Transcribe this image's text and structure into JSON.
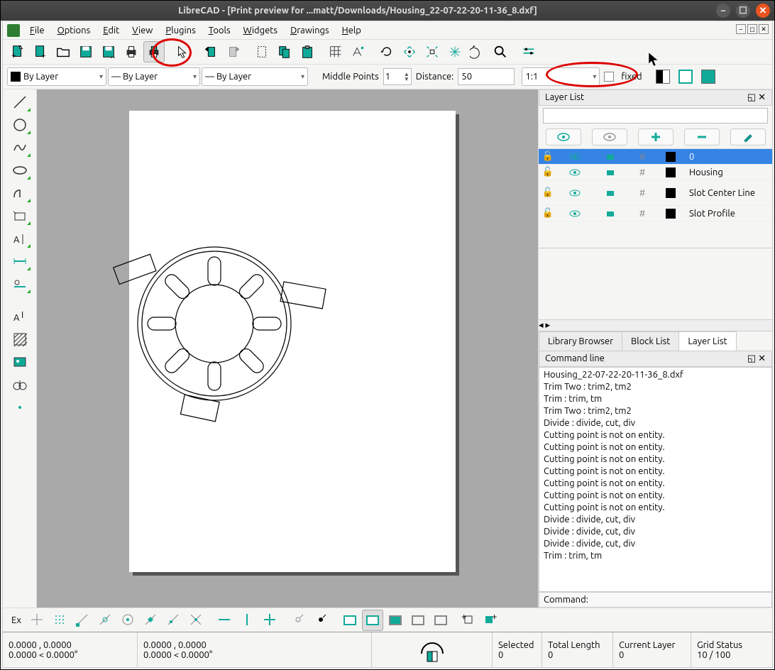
{
  "title": "LibreCAD - [Print preview for ...matt/Downloads/Housing_22-07-22-20-11-36_8.dxf]",
  "menu": {
    "file": "File",
    "options": "Options",
    "edit": "Edit",
    "view": "View",
    "plugins": "Plugins",
    "tools": "Tools",
    "widgets": "Widgets",
    "drawings": "Drawings",
    "help": "Help"
  },
  "row2": {
    "bylayer": "By Layer",
    "middle_points_label": "Middle Points",
    "middle_points_value": "1",
    "distance_label": "Distance:",
    "distance_value": "50",
    "scale_value": "1:1",
    "fixed_label": "fixed"
  },
  "layer_panel": {
    "title": "Layer List",
    "layers": [
      {
        "name": "0"
      },
      {
        "name": "Housing"
      },
      {
        "name": "Slot Center Line"
      },
      {
        "name": "Slot Profile"
      }
    ],
    "tabs": {
      "library": "Library Browser",
      "block": "Block List",
      "layer": "Layer List"
    }
  },
  "cmd": {
    "title": "Command line",
    "prompt": "Command:",
    "log": [
      "Housing_22-07-22-20-11-36_8.dxf",
      "Trim Two : trim2, tm2",
      "Trim : trim, tm",
      "Trim Two : trim2, tm2",
      "Divide : divide, cut, div",
      "Cutting point is not on entity.",
      "Cutting point is not on entity.",
      "Cutting point is not on entity.",
      "Cutting point is not on entity.",
      "Cutting point is not on entity.",
      "Cutting point is not on entity.",
      "Cutting point is not on entity.",
      "Divide : divide, cut, div",
      "Divide : divide, cut, div",
      "Divide : divide, cut, div",
      "Trim : trim, tm"
    ]
  },
  "bottom_label": "Ex",
  "status": {
    "coord1a": "0.0000 , 0.0000",
    "coord1b": "0.0000 < 0.0000°",
    "coord2a": "0.0000 , 0.0000",
    "coord2b": "0.0000 < 0.0000°",
    "selected_label": "Selected",
    "selected_val": "0",
    "total_label": "Total Length",
    "total_val": "0",
    "layer_label": "Current Layer",
    "layer_val": "0",
    "grid_label": "Grid Status",
    "grid_val": "10 / 100"
  }
}
